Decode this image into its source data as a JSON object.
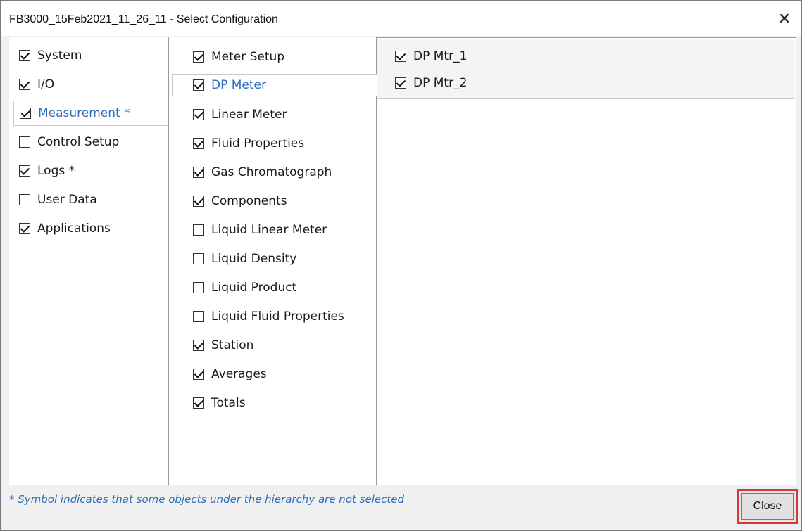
{
  "window": {
    "title": "FB3000_15Feb2021_11_26_11 - Select Configuration",
    "close_glyph": "✕"
  },
  "left_tree": [
    {
      "label": "System",
      "checked": true,
      "selected": false
    },
    {
      "label": "I/O",
      "checked": true,
      "selected": false
    },
    {
      "label": "Measurement *",
      "checked": true,
      "selected": true
    },
    {
      "label": "Control Setup",
      "checked": false,
      "selected": false
    },
    {
      "label": "Logs *",
      "checked": true,
      "selected": false
    },
    {
      "label": "User Data",
      "checked": false,
      "selected": false
    },
    {
      "label": "Applications",
      "checked": true,
      "selected": false
    }
  ],
  "mid_list": [
    {
      "label": "Meter Setup",
      "checked": true,
      "selected": false
    },
    {
      "label": "DP Meter",
      "checked": true,
      "selected": true
    },
    {
      "label": "Linear Meter",
      "checked": true,
      "selected": false
    },
    {
      "label": "Fluid Properties",
      "checked": true,
      "selected": false
    },
    {
      "label": "Gas Chromatograph",
      "checked": true,
      "selected": false
    },
    {
      "label": "Components",
      "checked": true,
      "selected": false
    },
    {
      "label": "Liquid Linear Meter",
      "checked": false,
      "selected": false
    },
    {
      "label": "Liquid Density",
      "checked": false,
      "selected": false
    },
    {
      "label": "Liquid Product",
      "checked": false,
      "selected": false
    },
    {
      "label": "Liquid Fluid Properties",
      "checked": false,
      "selected": false
    },
    {
      "label": "Station",
      "checked": true,
      "selected": false
    },
    {
      "label": "Averages",
      "checked": true,
      "selected": false
    },
    {
      "label": "Totals",
      "checked": true,
      "selected": false
    }
  ],
  "right_list": [
    {
      "label": "DP Mtr_1",
      "checked": true
    },
    {
      "label": "DP Mtr_2",
      "checked": true
    }
  ],
  "footer": {
    "note": "* Symbol indicates that some objects under the hierarchy are not selected",
    "close_label": "Close"
  },
  "colors": {
    "accent": "#2f6fba",
    "close_highlight": "#d33b3b"
  }
}
